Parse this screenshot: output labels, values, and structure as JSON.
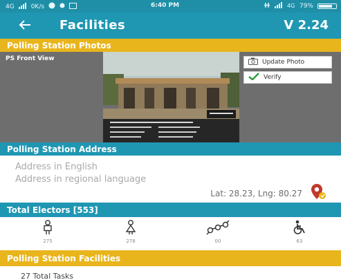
{
  "status_bar": {
    "left_text": "4G",
    "speed": "0K/s",
    "time": "6:40 PM",
    "battery_text": "79%",
    "battery_level": 0.79
  },
  "app_bar": {
    "back_icon": "arrow-left-icon",
    "title": "Facilities",
    "version": "V 2.24"
  },
  "photos_section": {
    "header": "Polling Station Photos",
    "photo_label": "PS Front View",
    "update_label": "Update Photo",
    "verify_label": "Verify"
  },
  "address_section": {
    "header": "Polling Station Address",
    "english_placeholder": "Address in English",
    "regional_placeholder": "Address in regional language",
    "latlng": "Lat: 28.23, Lng: 80.27"
  },
  "electors_section": {
    "header": "Total Electors [553]",
    "items": [
      {
        "icon": "male-icon",
        "count": "275"
      },
      {
        "icon": "female-icon",
        "count": "278"
      },
      {
        "icon": "third-gender-icon",
        "count": "00"
      },
      {
        "icon": "wheelchair-icon",
        "count": "63"
      }
    ]
  },
  "facilities_section": {
    "header": "Polling Station Facilities",
    "tasks": "27 Total Tasks"
  },
  "colors": {
    "teal": "#1f97b3",
    "yellow": "#e9b51c",
    "verify_green": "#2e9e3e",
    "pin_red": "#c0392b"
  }
}
